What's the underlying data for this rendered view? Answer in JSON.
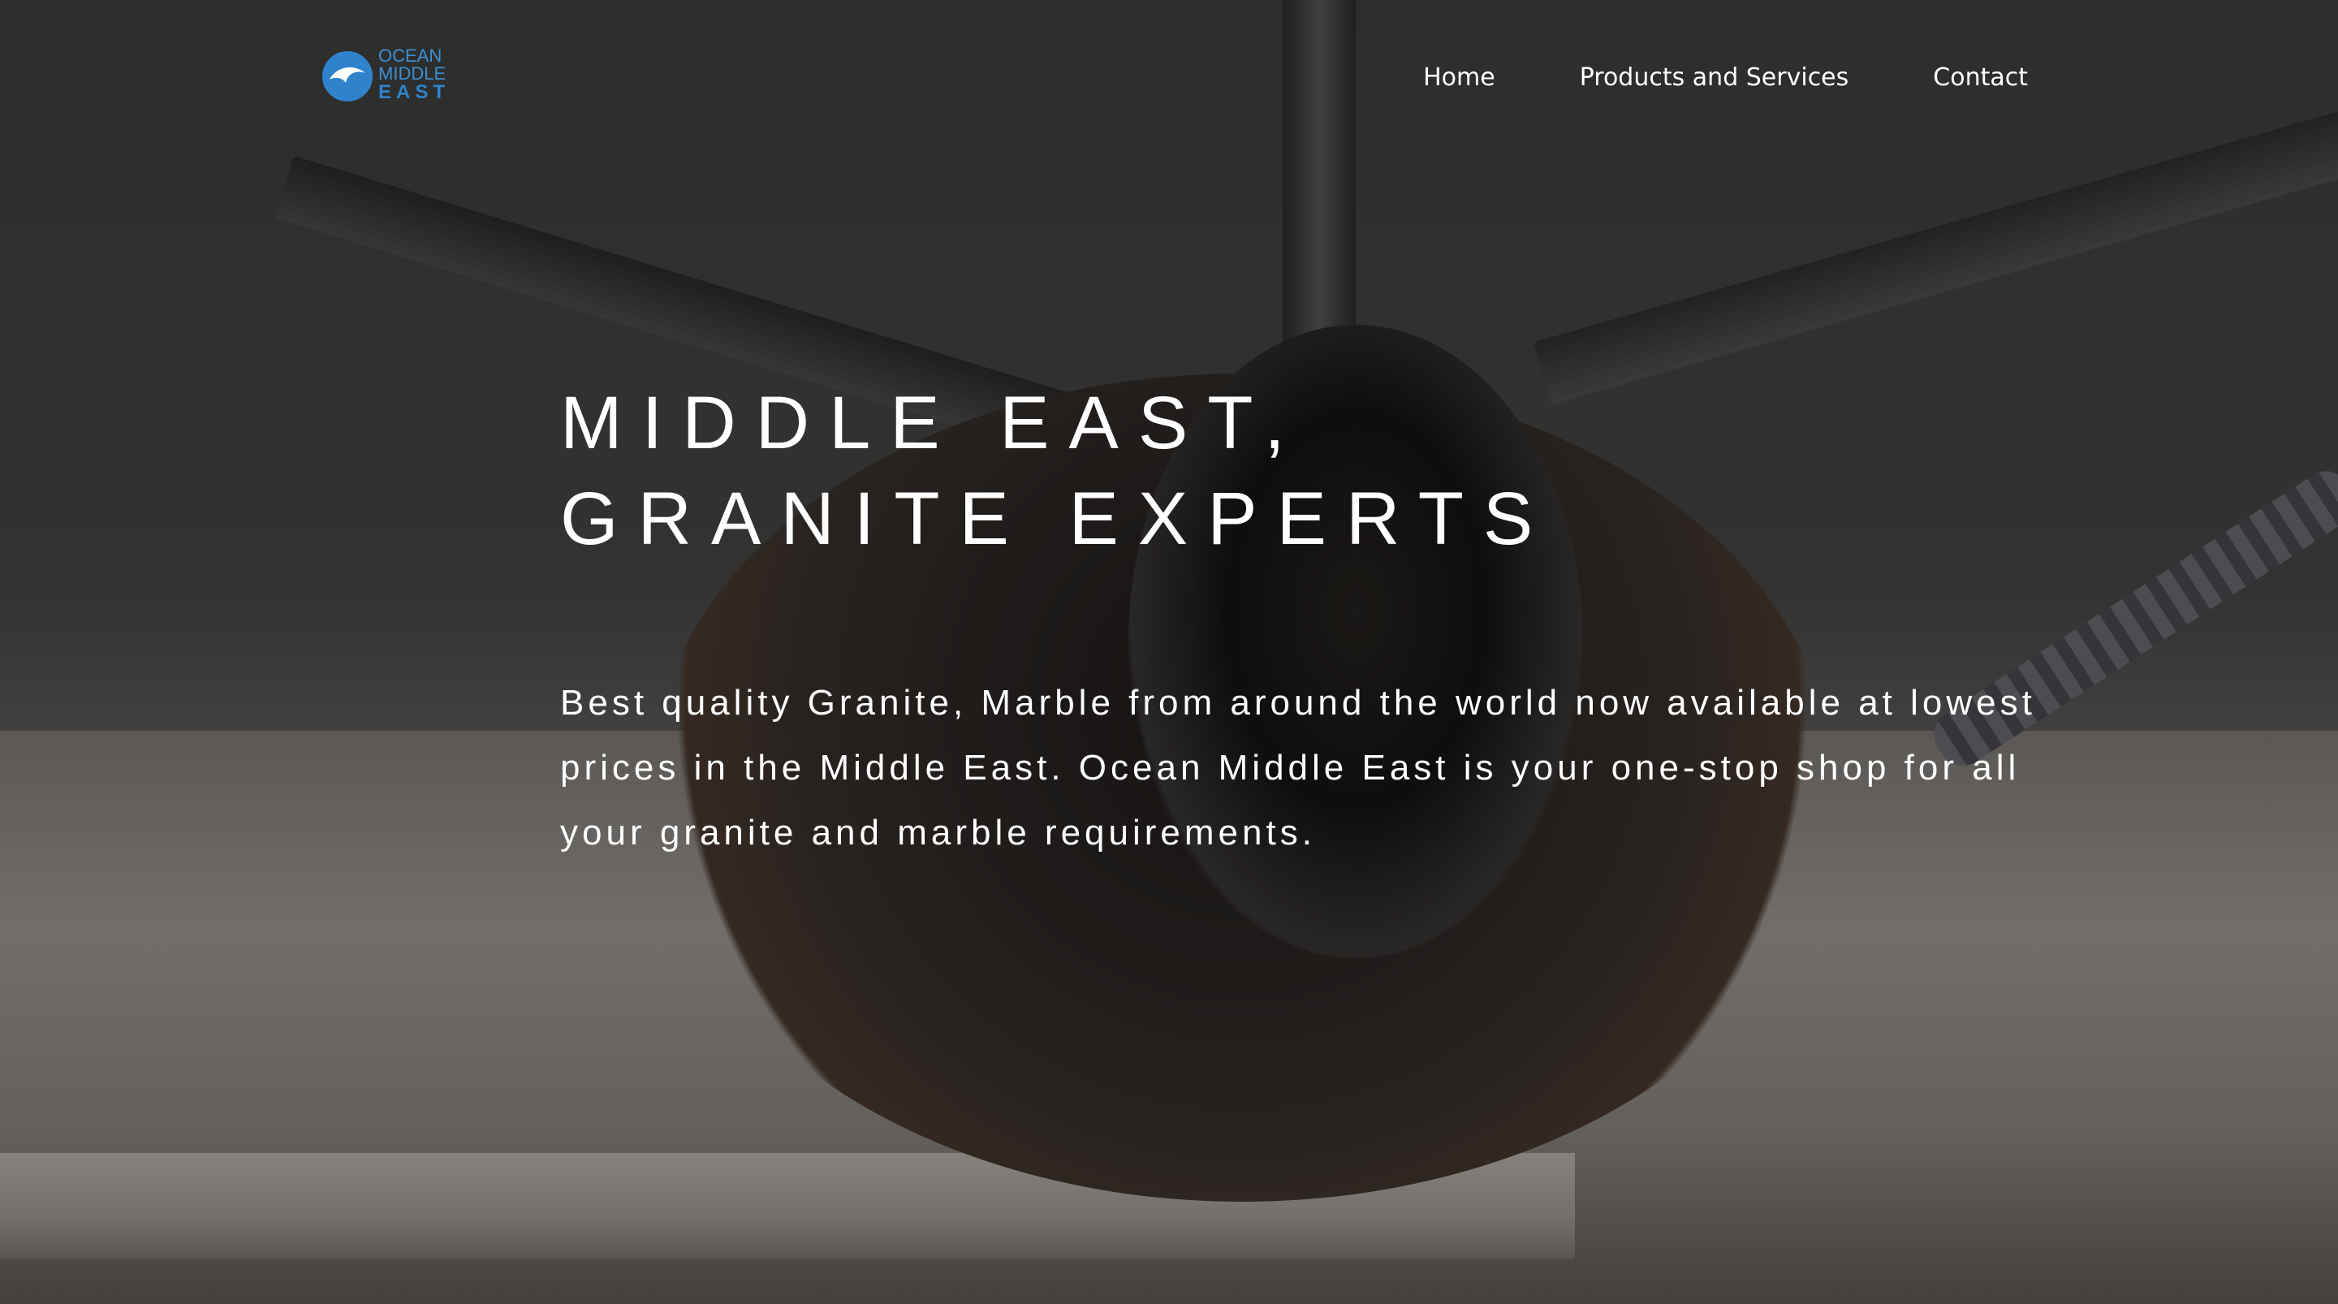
{
  "header": {
    "logo": {
      "line1": "OCEAN",
      "line2": "MIDDLE",
      "line3": "EAST",
      "color": "#3c8fd2"
    },
    "nav": [
      {
        "label": "Home"
      },
      {
        "label": "Products and Services"
      },
      {
        "label": "Contact"
      }
    ]
  },
  "hero": {
    "title": "MIDDLE EAST, GRANITE EXPERTS",
    "description": "Best quality Granite, Marble from around the world now available at lowest prices in the Middle East. Ocean Middle East is your one-stop shop for all your granite and marble requirements."
  }
}
